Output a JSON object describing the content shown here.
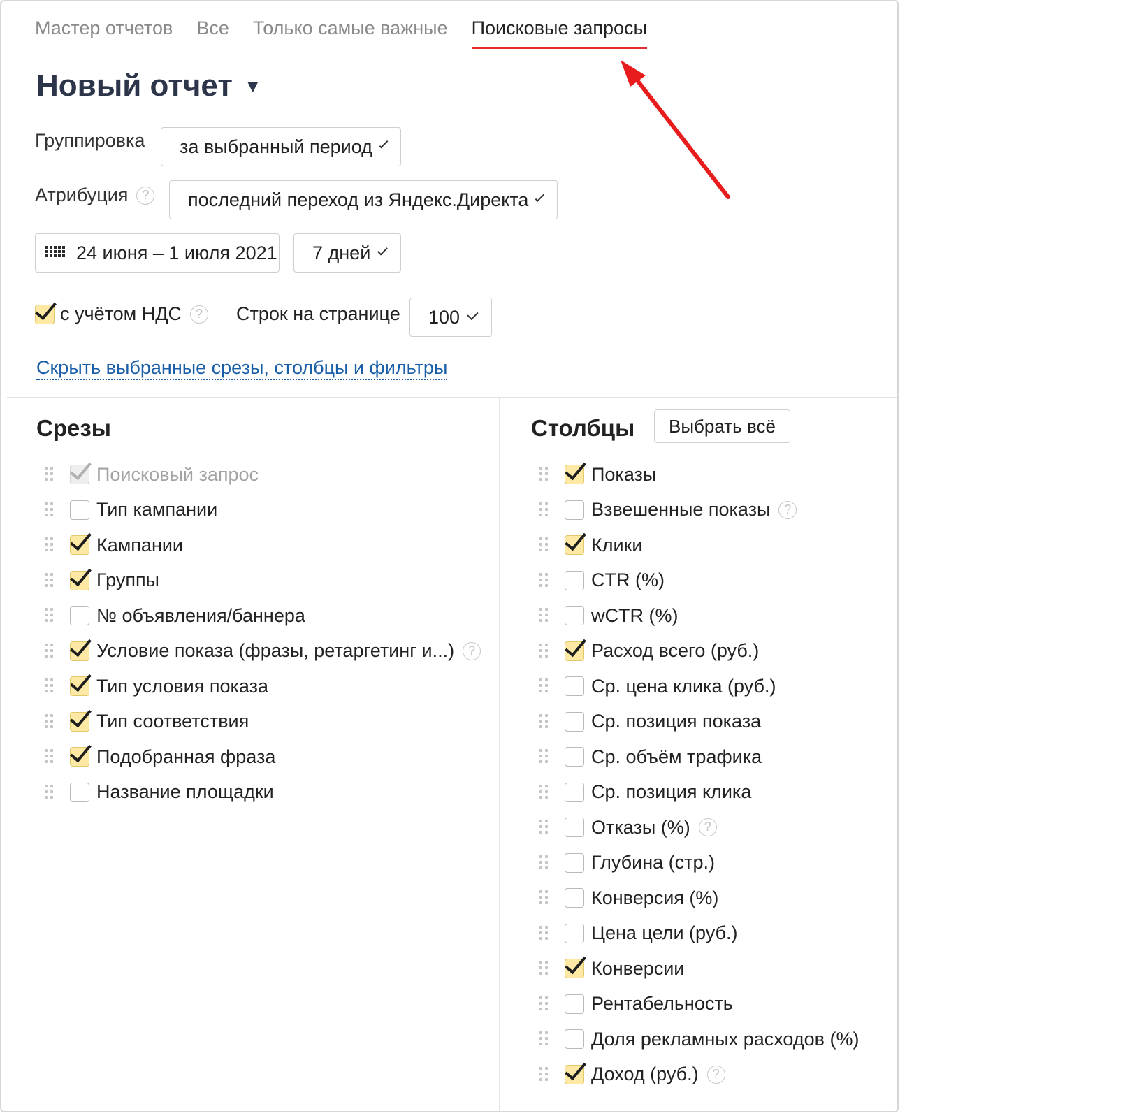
{
  "tabs": [
    {
      "label": "Мастер отчетов",
      "active": false
    },
    {
      "label": "Все",
      "active": false
    },
    {
      "label": "Только самые важные",
      "active": false
    },
    {
      "label": "Поисковые запросы",
      "active": true
    }
  ],
  "report": {
    "title": "Новый отчет"
  },
  "grouping": {
    "label": "Группировка",
    "value": "за выбранный период"
  },
  "attribution": {
    "label": "Атрибуция",
    "value": "последний переход из Яндекс.Директа"
  },
  "period": {
    "date_range": "24 июня – 1 июля 2021",
    "preset": "7 дней"
  },
  "vat": {
    "label": "с учётом НДС",
    "checked": true
  },
  "rows_per_page": {
    "label": "Строк на странице",
    "value": "100"
  },
  "toggle_link": "Скрыть выбранные срезы, столбцы и фильтры",
  "slices": {
    "title": "Срезы",
    "items": [
      {
        "label": "Поисковый запрос",
        "checked": true,
        "disabled": true,
        "help": false
      },
      {
        "label": "Тип кампании",
        "checked": false,
        "disabled": false,
        "help": false
      },
      {
        "label": "Кампании",
        "checked": true,
        "disabled": false,
        "help": false
      },
      {
        "label": "Группы",
        "checked": true,
        "disabled": false,
        "help": false
      },
      {
        "label": "№ объявления/баннера",
        "checked": false,
        "disabled": false,
        "help": false
      },
      {
        "label": "Условие показа (фразы, ретаргетинг и...)",
        "checked": true,
        "disabled": false,
        "help": true
      },
      {
        "label": "Тип условия показа",
        "checked": true,
        "disabled": false,
        "help": false
      },
      {
        "label": "Тип соответствия",
        "checked": true,
        "disabled": false,
        "help": false
      },
      {
        "label": "Подобранная фраза",
        "checked": true,
        "disabled": false,
        "help": false
      },
      {
        "label": "Название площадки",
        "checked": false,
        "disabled": false,
        "help": false
      }
    ]
  },
  "columns": {
    "title": "Столбцы",
    "select_all_label": "Выбрать всё",
    "items": [
      {
        "label": "Показы",
        "checked": true,
        "help": false
      },
      {
        "label": "Взвешенные показы",
        "checked": false,
        "help": true
      },
      {
        "label": "Клики",
        "checked": true,
        "help": false
      },
      {
        "label": "CTR (%)",
        "checked": false,
        "help": false
      },
      {
        "label": "wCTR (%)",
        "checked": false,
        "help": false
      },
      {
        "label": "Расход всего (руб.)",
        "checked": true,
        "help": false
      },
      {
        "label": "Ср. цена клика (руб.)",
        "checked": false,
        "help": false
      },
      {
        "label": "Ср. позиция показа",
        "checked": false,
        "help": false
      },
      {
        "label": "Ср. объём трафика",
        "checked": false,
        "help": false
      },
      {
        "label": "Ср. позиция клика",
        "checked": false,
        "help": false
      },
      {
        "label": "Отказы (%)",
        "checked": false,
        "help": true
      },
      {
        "label": "Глубина (стр.)",
        "checked": false,
        "help": false
      },
      {
        "label": "Конверсия (%)",
        "checked": false,
        "help": false
      },
      {
        "label": "Цена цели (руб.)",
        "checked": false,
        "help": false
      },
      {
        "label": "Конверсии",
        "checked": true,
        "help": false
      },
      {
        "label": "Рентабельность",
        "checked": false,
        "help": false
      },
      {
        "label": "Доля рекламных расходов (%)",
        "checked": false,
        "help": false
      },
      {
        "label": "Доход (руб.)",
        "checked": true,
        "help": true
      }
    ]
  },
  "colors": {
    "accent_underline": "#e52b2b",
    "annotation_arrow": "#e81c1c",
    "checkbox_checked": "#fde9a4",
    "link": "#1a5ea8",
    "title": "#2c3549"
  },
  "icons": {
    "help": "question-circle-icon",
    "calendar": "calendar-grid-icon",
    "drag": "drag-handle-icon",
    "dropdown": "chevron-down-icon",
    "title_menu": "triangle-down-icon"
  }
}
